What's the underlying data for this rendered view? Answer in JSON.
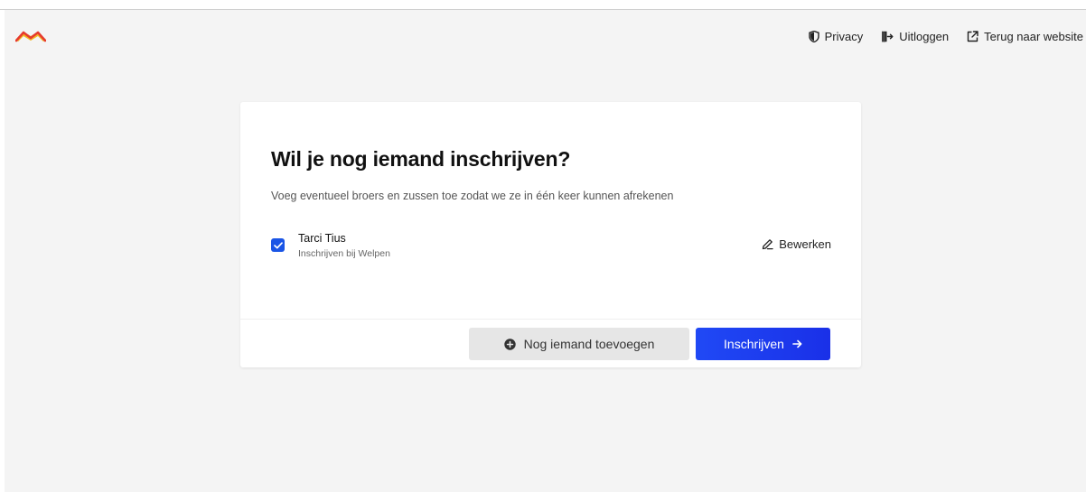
{
  "header": {
    "logo_icon": "chevron-wave-logo",
    "links": [
      {
        "label": "Privacy",
        "icon": "shield-icon"
      },
      {
        "label": "Uitloggen",
        "icon": "logout-icon"
      },
      {
        "label": "Terug naar website",
        "icon": "external-link-icon"
      }
    ]
  },
  "card": {
    "title": "Wil je nog iemand inschrijven?",
    "subtitle": "Voeg eventueel broers en zussen toe zodat we ze in één keer kunnen afrekenen",
    "members": [
      {
        "name": "Tarci Tius",
        "info": "Inschrijven bij Welpen",
        "checked": true,
        "edit_label": "Bewerken"
      }
    ],
    "add_button_label": "Nog iemand toevoegen",
    "submit_button_label": "Inschrijven"
  },
  "colors": {
    "primary": "#1f3df0",
    "background": "#f4f4f4",
    "logo_red": "#e63a2e",
    "logo_yellow": "#f2b824"
  }
}
